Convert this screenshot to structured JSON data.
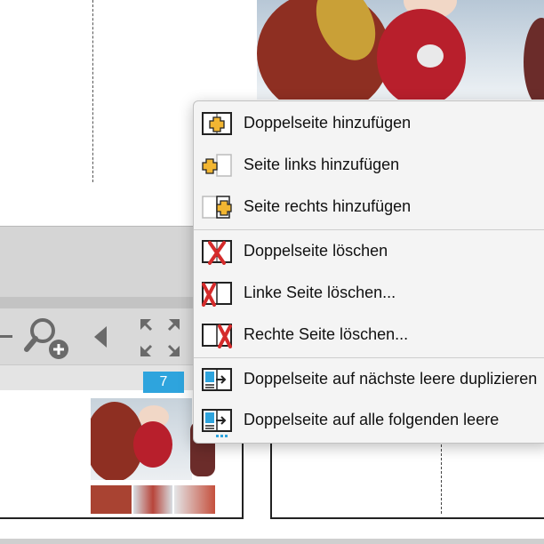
{
  "page_badge": "7",
  "context_menu": {
    "items": [
      {
        "label": "Doppelseite hinzufügen",
        "icon": "add-spread-icon"
      },
      {
        "label": "Seite links hinzufügen",
        "icon": "add-left-page-icon"
      },
      {
        "label": "Seite rechts hinzufügen",
        "icon": "add-right-page-icon"
      },
      {
        "label": "Doppelseite löschen",
        "icon": "delete-spread-icon"
      },
      {
        "label": "Linke Seite löschen...",
        "icon": "delete-left-page-icon"
      },
      {
        "label": "Rechte Seite löschen...",
        "icon": "delete-right-page-icon"
      },
      {
        "label": "Doppelseite auf nächste leere duplizieren",
        "icon": "duplicate-next-icon"
      },
      {
        "label": "Doppelseite auf alle folgenden leere",
        "icon": "duplicate-all-icon"
      }
    ]
  },
  "toolbar": {
    "icons": [
      "minus-icon",
      "zoom-in-icon",
      "previous-arrow-icon",
      "fit-page-icon"
    ]
  },
  "colors": {
    "accent": "#2ea4dd",
    "plus_yellow": "#f2b632",
    "delete_red": "#d52b2b",
    "menu_bg": "#f4f4f4"
  }
}
